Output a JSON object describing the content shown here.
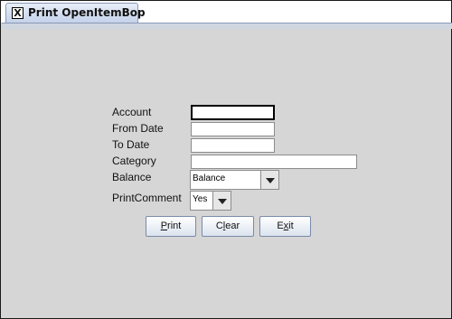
{
  "tab": {
    "title": "Print OpenItemBop",
    "close_glyph": "X"
  },
  "form": {
    "account_label": "Account",
    "account_value": "",
    "from_date_label": "From Date",
    "from_date_value": "",
    "to_date_label": "To Date",
    "to_date_value": "",
    "category_label": "Category",
    "category_value": "",
    "balance_label": "Balance",
    "balance_selected": "Balance",
    "print_comment_label": "PrintComment",
    "print_comment_selected": "Yes"
  },
  "buttons": {
    "print": {
      "mnemonic": "P",
      "rest": "rint"
    },
    "clear": {
      "pre": "C",
      "mnemonic": "l",
      "rest": "ear"
    },
    "exit": {
      "pre": "E",
      "mnemonic": "x",
      "rest": "it"
    }
  }
}
